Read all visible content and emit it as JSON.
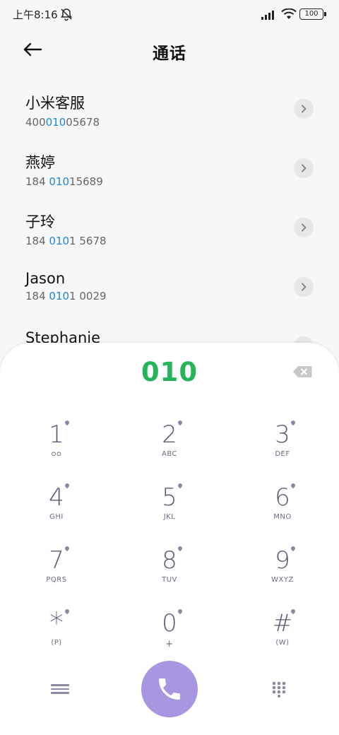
{
  "status_bar": {
    "time": "上午8:16",
    "battery": "100"
  },
  "header": {
    "title": "通话"
  },
  "contacts": [
    {
      "name": "小米客服",
      "num_pre": "400",
      "num_hl": "010",
      "num_post": "05678"
    },
    {
      "name": "燕婷",
      "num_pre": "184 ",
      "num_hl": "010",
      "num_post": "15689"
    },
    {
      "name": "子玲",
      "num_pre": "184 ",
      "num_hl": "010",
      "num_post": "1 5678"
    },
    {
      "name": "Jason",
      "num_pre": "184 ",
      "num_hl": "010",
      "num_post": "1 0029"
    },
    {
      "name": "Stephanie",
      "num_pre": "",
      "num_hl": "",
      "num_post": ""
    }
  ],
  "dialpad": {
    "typed_number": "010",
    "keys": [
      {
        "digit": "1",
        "letters": "ᴑᴑ"
      },
      {
        "digit": "2",
        "letters": "ABC"
      },
      {
        "digit": "3",
        "letters": "DEF"
      },
      {
        "digit": "4",
        "letters": "GHI"
      },
      {
        "digit": "5",
        "letters": "JKL"
      },
      {
        "digit": "6",
        "letters": "MNO"
      },
      {
        "digit": "7",
        "letters": "PQRS"
      },
      {
        "digit": "8",
        "letters": "TUV"
      },
      {
        "digit": "9",
        "letters": "WXYZ"
      },
      {
        "digit": "*",
        "letters": "(P)"
      },
      {
        "digit": "0",
        "letters": "+"
      },
      {
        "digit": "#",
        "letters": "(W)"
      }
    ]
  },
  "colors": {
    "typed_number": "#27b35a",
    "highlight": "#1e88d2",
    "call_button": "#a897e0",
    "key_text": "#5a5a7a"
  }
}
